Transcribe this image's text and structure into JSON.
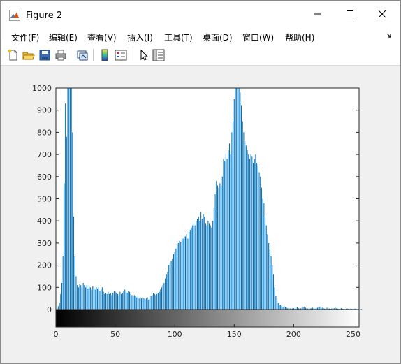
{
  "window": {
    "title": "Figure 2",
    "controls": {
      "minimize": "minimize",
      "maximize": "maximize",
      "close": "close"
    }
  },
  "menubar": {
    "items": [
      "文件(F)",
      "编辑(E)",
      "查看(V)",
      "插入(I)",
      "工具(T)",
      "桌面(D)",
      "窗口(W)",
      "帮助(H)"
    ]
  },
  "toolbar": {
    "icons": [
      "new-figure-icon",
      "open-file-icon",
      "save-icon",
      "print-icon",
      "link-plot-icon",
      "insert-colorbar-icon",
      "insert-legend-icon",
      "edit-plot-arrow-icon",
      "property-inspector-icon"
    ]
  },
  "colors": {
    "bar": "#0072bd",
    "axis": "#262626",
    "window_bg": "#f0f0f0"
  },
  "chart_data": {
    "type": "bar",
    "title": "",
    "xlabel": "",
    "ylabel": "",
    "xlim": [
      0,
      255
    ],
    "ylim": [
      0,
      1000
    ],
    "yticks": [
      0,
      100,
      200,
      300,
      400,
      500,
      600,
      700,
      800,
      900,
      1000
    ],
    "xticks": [
      0,
      50,
      100,
      150,
      200,
      250
    ],
    "colorbar": "grayscale gradient 0 to 255 beneath the x axis",
    "grid": false,
    "series": [
      {
        "values": [
          0,
          5,
          15,
          30,
          70,
          120,
          240,
          570,
          930,
          780,
          1000,
          1030,
          1030,
          1030,
          800,
          420,
          240,
          150,
          110,
          100,
          115,
          110,
          100,
          120,
          110,
          100,
          110,
          95,
          105,
          100,
          90,
          105,
          100,
          90,
          100,
          95,
          100,
          85,
          95,
          100,
          80,
          70,
          75,
          70,
          80,
          70,
          75,
          65,
          75,
          85,
          80,
          75,
          70,
          65,
          80,
          70,
          75,
          85,
          90,
          80,
          75,
          85,
          80,
          70,
          65,
          60,
          65,
          60,
          55,
          60,
          50,
          55,
          50,
          55,
          50,
          45,
          50,
          55,
          45,
          50,
          60,
          65,
          75,
          70,
          65,
          70,
          75,
          80,
          90,
          100,
          110,
          120,
          140,
          160,
          170,
          200,
          210,
          220,
          230,
          250,
          260,
          275,
          290,
          300,
          310,
          305,
          315,
          320,
          330,
          330,
          340,
          320,
          350,
          360,
          370,
          380,
          390,
          380,
          400,
          410,
          420,
          400,
          440,
          410,
          430,
          420,
          390,
          380,
          400,
          390,
          380,
          370,
          400,
          460,
          520,
          580,
          560,
          550,
          570,
          560,
          600,
          680,
          670,
          700,
          680,
          720,
          750,
          700,
          800,
          850,
          950,
          1000,
          1030,
          1030,
          1030,
          980,
          920,
          850,
          800,
          760,
          740,
          720,
          700,
          680,
          700,
          690,
          660,
          680,
          700,
          660,
          650,
          620,
          600,
          550,
          500,
          480,
          420,
          380,
          340,
          300,
          270,
          240,
          200,
          160,
          100,
          60,
          40,
          30,
          20,
          20,
          15,
          12,
          15,
          10,
          8,
          6,
          5,
          5,
          4,
          5,
          6,
          4,
          8,
          10,
          6,
          4,
          5,
          8,
          10,
          12,
          8,
          6,
          5,
          4,
          5,
          6,
          8,
          5,
          4,
          6,
          8,
          10,
          12,
          10,
          8,
          6,
          4,
          5,
          8,
          6,
          4,
          3,
          5,
          4,
          6,
          8,
          5,
          4,
          3,
          5,
          6,
          4,
          3,
          2,
          4,
          5,
          3,
          2,
          4,
          3,
          2,
          3,
          4,
          2,
          1,
          2,
          3,
          2,
          1,
          0
        ]
      }
    ]
  }
}
